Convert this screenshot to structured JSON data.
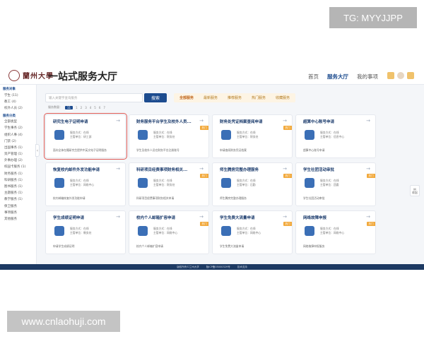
{
  "watermarks": {
    "top": "TG: MYYJJPP",
    "bottom": "www.cnlaohuji.com"
  },
  "header": {
    "logo_text": "蘭州大學",
    "app_title": "一站式服务大厅",
    "nav": [
      {
        "label": "首页",
        "active": false
      },
      {
        "label": "服务大厅",
        "active": true
      },
      {
        "label": "我的事项",
        "active": false
      }
    ]
  },
  "sidebar": {
    "sections": [
      {
        "title": "服务对象",
        "items": [
          "学生 (11)",
          "教工 (4)",
          "校外人员 (2)"
        ]
      },
      {
        "title": "服务分类",
        "items": [
          "全部类型",
          "学生事务 (2)",
          "组织人事 (4)",
          "门禁 (2)",
          "出国事务 (1)",
          "资产管理 (1)",
          "外事办理 (2)",
          "校园卡服务 (1)",
          "财务服务 (1)",
          "科研服务 (1)",
          "图书服务 (1)",
          "主题服务 (1)",
          "教学服务 (1)",
          "保卫服务",
          "事项服务",
          "其他服务"
        ]
      }
    ]
  },
  "toolbar": {
    "search_placeholder": "输入关键字查询服务",
    "search_label": "搜索",
    "tabs": [
      {
        "label": "全部服务",
        "active": true
      },
      {
        "label": "最新服务",
        "active": false
      },
      {
        "label": "推荐服务",
        "active": false
      },
      {
        "label": "热门服务",
        "active": false
      },
      {
        "label": "收藏服务",
        "active": false
      }
    ]
  },
  "pager": {
    "label": "服务数量：",
    "current": "11",
    "pages": [
      "1",
      "2",
      "3",
      "4",
      "5",
      "6",
      "7"
    ]
  },
  "cards": [
    {
      "title": "研究生电子证明申请",
      "badge": "",
      "meta1": "服务方式：在线",
      "meta2": "主管单位：研工部",
      "desc": "面向全体在籍研究生提供中英文电子证明服务",
      "icon": "document-icon",
      "color": "#3b6fb6"
    },
    {
      "title": "财务服务平台学生及校外人员...",
      "badge": "热门",
      "meta1": "服务方式：在线",
      "meta2": "主管单位：财务处",
      "desc": "学生及校外人员在财务平台注册账号",
      "icon": "finance-icon",
      "color": "#3b6fb6"
    },
    {
      "title": "财务处凭证档案查阅申请",
      "badge": "热门",
      "meta1": "服务方式：在线",
      "meta2": "主管单位：财务处",
      "desc": "申请查阅财务凭证档案",
      "icon": "archive-icon",
      "color": "#3b6fb6"
    },
    {
      "title": "超算中心账号申请",
      "badge": "",
      "meta1": "服务方式：在线",
      "meta2": "主管单位：信息中心",
      "desc": "超算中心账号申请",
      "icon": "flask-icon",
      "color": "#3b6fb6"
    },
    {
      "title": "恢复校内邮件外发功能申请",
      "badge": "",
      "meta1": "服务方式：在线",
      "meta2": "主管单位：网络中心",
      "desc": "校内邮箱恢复外发功能申请",
      "icon": "globe-icon",
      "color": "#3b6fb6"
    },
    {
      "title": "科研项目经费事项财务相关...",
      "badge": "热门",
      "meta1": "服务方式：在线",
      "meta2": "主管单位：财务处",
      "desc": "科研项目经费事项财务相关申请",
      "icon": "grid-icon",
      "color": "#3b6fb6"
    },
    {
      "title": "师生腾房完整办理服务",
      "badge": "热门",
      "meta1": "服务方式：在线",
      "meta2": "主管单位：后勤",
      "desc": "师生腾房完整办理服务",
      "icon": "clipboard-icon",
      "color": "#3b6fb6"
    },
    {
      "title": "学生社团活动审批",
      "badge": "热门",
      "meta1": "服务方式：在线",
      "meta2": "主管单位：团委",
      "desc": "学生社团活动审批",
      "icon": "form-icon",
      "color": "#3b6fb6"
    },
    {
      "title": "学生成绩证明申请",
      "badge": "",
      "meta1": "服务方式：在线",
      "meta2": "主管单位：教务处",
      "desc": "申请学生成绩证明",
      "icon": "globe-icon",
      "color": "#3b6fb6"
    },
    {
      "title": "校内个人邮箱扩容申请",
      "badge": "热门",
      "meta1": "服务方式：在线",
      "meta2": "主管单位：网络中心",
      "desc": "校内个人邮箱扩容申请",
      "icon": "mail-icon",
      "color": "#3b6fb6"
    },
    {
      "title": "学生免费大流量申请",
      "badge": "热门",
      "meta1": "服务方式：在线",
      "meta2": "主管单位：网络中心",
      "desc": "学生免费大流量申请",
      "icon": "data-icon",
      "color": "#3b6fb6"
    },
    {
      "title": "网络故障申报",
      "badge": "热门",
      "meta1": "服务方式：在线",
      "meta2": "主管单位：网络中心",
      "desc": "网络故障申报服务",
      "icon": "network-icon",
      "color": "#3b6fb6"
    }
  ],
  "float_button": {
    "label": "收起"
  },
  "footer": {
    "left": "版权所有©兰州大学",
    "mid": "陇ICP备05000329号",
    "right": "技术支持"
  },
  "colors": {
    "primary": "#1d4c8f",
    "accent": "#f2a93b",
    "highlight": "#e05b55"
  }
}
